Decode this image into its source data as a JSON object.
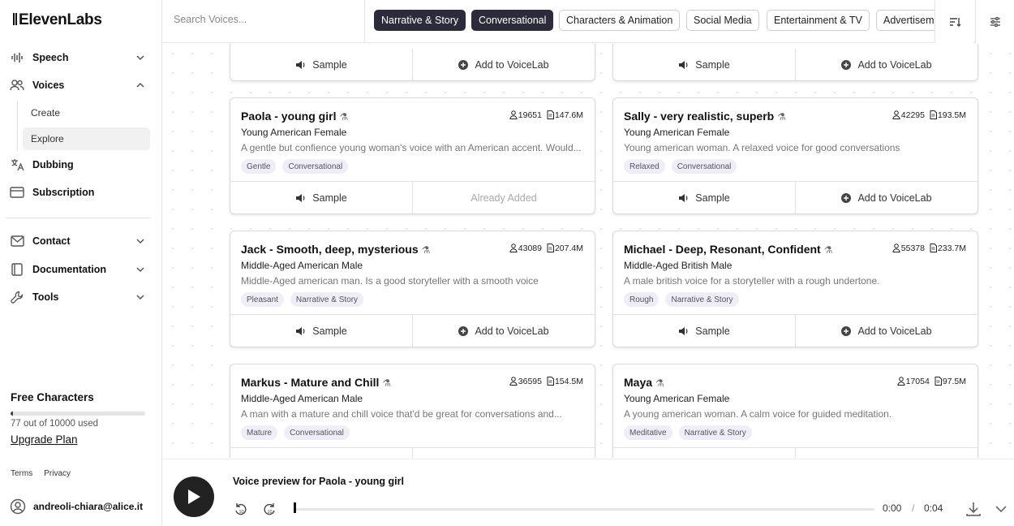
{
  "app": {
    "logo": "ElevenLabs"
  },
  "sidebar": {
    "nav": [
      {
        "label": "Speech",
        "icon": "waveform-icon",
        "chevron": "down"
      },
      {
        "label": "Voices",
        "icon": "users-icon",
        "chevron": "up"
      },
      {
        "label": "Dubbing",
        "icon": "translate-icon"
      },
      {
        "label": "Subscription",
        "icon": "card-icon"
      },
      {
        "label": "Contact",
        "icon": "mail-icon",
        "chevron": "down"
      },
      {
        "label": "Documentation",
        "icon": "book-icon",
        "chevron": "down"
      },
      {
        "label": "Tools",
        "icon": "wrench-icon",
        "chevron": "down"
      }
    ],
    "voices_sub": [
      {
        "label": "Create",
        "active": false
      },
      {
        "label": "Explore",
        "active": true
      }
    ],
    "free_characters": {
      "title": "Free Characters",
      "used": 77,
      "total": 10000,
      "usage_text": "77 out of 10000 used",
      "upgrade_label": "Upgrade Plan"
    },
    "footer": {
      "terms": "Terms",
      "privacy": "Privacy"
    },
    "user_email": "andreoli-chiara@alice.it"
  },
  "topbar": {
    "search_placeholder": "Search Voices...",
    "chips": [
      {
        "label": "Narrative & Story",
        "active": true
      },
      {
        "label": "Conversational",
        "active": true
      },
      {
        "label": "Characters & Animation",
        "active": false
      },
      {
        "label": "Social Media",
        "active": false
      },
      {
        "label": "Entertainment & TV",
        "active": false
      },
      {
        "label": "Advertisement",
        "active": false
      }
    ],
    "sort_icon": "sort-icon",
    "filter_icon": "sliders-icon"
  },
  "actions": {
    "sample": "Sample",
    "add": "Add to VoiceLab",
    "added": "Already Added"
  },
  "voices": [
    {
      "name": "Paola - young girl",
      "users": "19651",
      "chars": "147.6M",
      "desc": "Young American Female",
      "detail": "A gentle but confience young woman's voice with an American accent. Would...",
      "tags": [
        "Gentle",
        "Conversational"
      ],
      "added": true
    },
    {
      "name": "Sally - very realistic, superb",
      "users": "42295",
      "chars": "193.5M",
      "desc": "Young American Female",
      "detail": "Young american woman. A relaxed voice for good conversations",
      "tags": [
        "Relaxed",
        "Conversational"
      ],
      "added": false
    },
    {
      "name": "Jack - Smooth, deep, mysterious",
      "users": "43089",
      "chars": "207.4M",
      "desc": "Middle-Aged American Male",
      "detail": "Middle-Aged american man. Is a good storyteller with a smooth voice",
      "tags": [
        "Pleasant",
        "Narrative & Story"
      ],
      "added": false
    },
    {
      "name": "Michael - Deep, Resonant, Confident",
      "users": "55378",
      "chars": "233.7M",
      "desc": "Middle-Aged British Male",
      "detail": "A male british voice for a storyteller with a rough undertone.",
      "tags": [
        "Rough",
        "Narrative & Story"
      ],
      "added": false
    },
    {
      "name": "Markus - Mature and Chill",
      "users": "36595",
      "chars": "154.5M",
      "desc": "Middle-Aged American Male",
      "detail": "A man with a mature and chill voice that'd be great for conversations and...",
      "tags": [
        "Mature",
        "Conversational"
      ],
      "added": false
    },
    {
      "name": "Maya",
      "users": "17054",
      "chars": "97.5M",
      "desc": "Young American Female",
      "detail": "A young american woman. A calm voice for guided meditation.",
      "tags": [
        "Meditative",
        "Narrative & Story"
      ],
      "added": false
    }
  ],
  "player": {
    "title": "Voice preview for Paola - young girl",
    "current": "0:00",
    "separator": "/",
    "duration": "0:04",
    "progress": 0
  }
}
